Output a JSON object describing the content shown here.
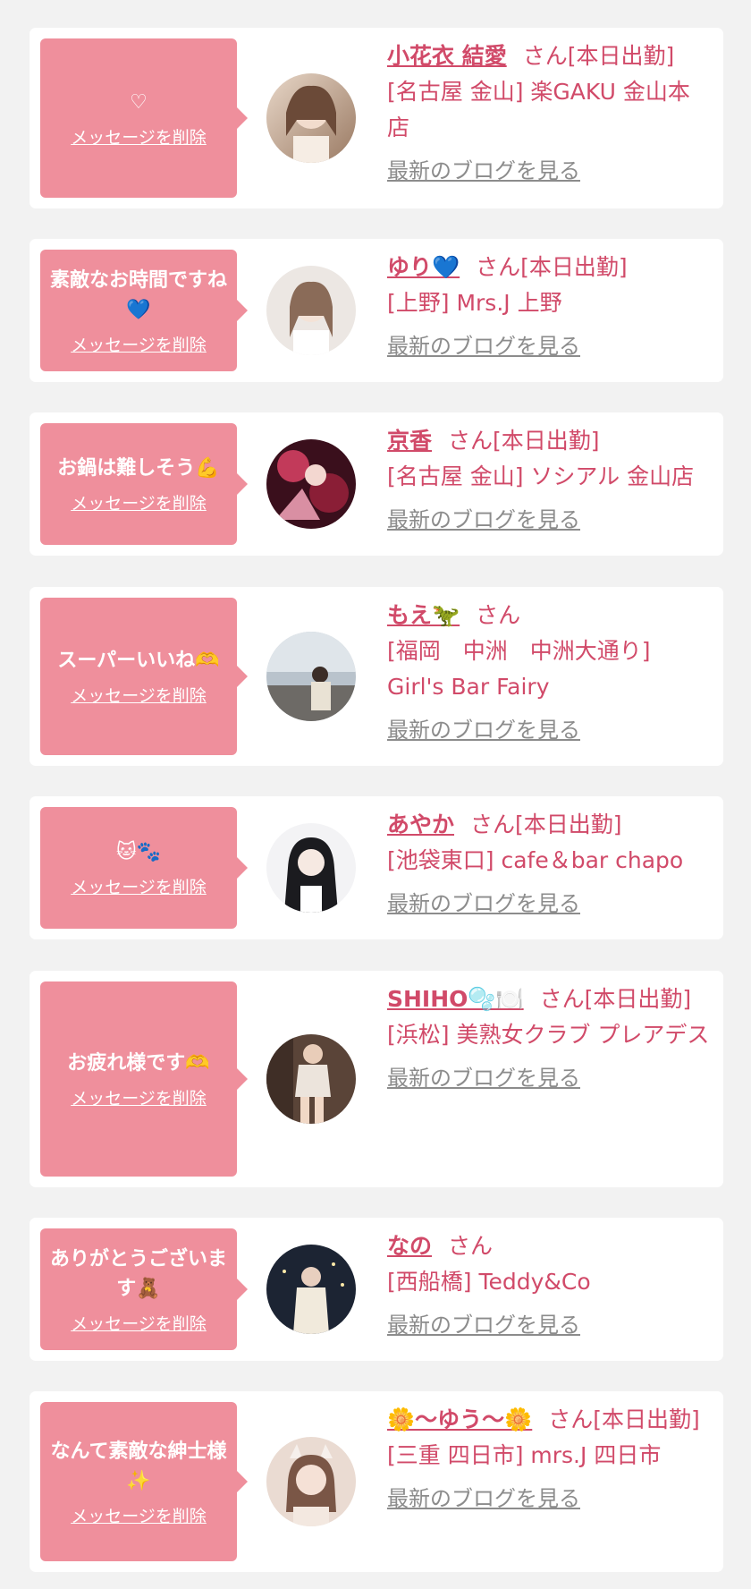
{
  "colors": {
    "background": "#f2f2f2",
    "card": "#ffffff",
    "bubble": "#ef8f9c",
    "accent": "#d14a69",
    "link_gray": "#8c8c8c"
  },
  "delete_label": "メッセージを削除",
  "blog_label": "最新のブログを見る",
  "items": [
    {
      "message": "♡",
      "name": "小花衣 結愛",
      "san": "さん[本日出勤]",
      "shop": "[名古屋 金山] 楽GAKU 金山本店",
      "avatar_icon": "avatar-photo"
    },
    {
      "message": "素敵なお時間ですね💙",
      "name": "ゆり💙",
      "san": "さん[本日出勤]",
      "shop": "[上野] Mrs.J 上野",
      "avatar_icon": "avatar-photo"
    },
    {
      "message": "お鍋は難しそう💪",
      "name": "京香",
      "san": "さん[本日出勤]",
      "shop": "[名古屋 金山] ソシアル 金山店",
      "avatar_icon": "avatar-photo"
    },
    {
      "message": "スーパーいいね🫶",
      "name": "もえ🦖",
      "san": "さん",
      "shop": "[福岡　中洲　中洲大通り] Girl's Bar Fairy",
      "avatar_icon": "avatar-photo"
    },
    {
      "message": "🐱🐾",
      "name": "あやか",
      "san": "さん[本日出勤]",
      "shop": "[池袋東口] cafe＆bar chapo",
      "avatar_icon": "avatar-photo"
    },
    {
      "message": "お疲れ様です🫶",
      "name": "SHIHO🫧🍽️",
      "san": "さん[本日出勤]",
      "shop": "[浜松] 美熟女クラブ プレアデス",
      "avatar_icon": "avatar-photo"
    },
    {
      "message": "ありがとうございます🧸",
      "name": "なの",
      "san": "さん",
      "shop": "[西船橋] Teddy&Co",
      "avatar_icon": "avatar-photo"
    },
    {
      "message": "なんて素敵な紳士様✨",
      "name": "🌼〜ゆう〜🌼",
      "san": "さん[本日出勤]",
      "shop": "[三重 四日市] mrs.J 四日市",
      "avatar_icon": "avatar-photo"
    }
  ]
}
